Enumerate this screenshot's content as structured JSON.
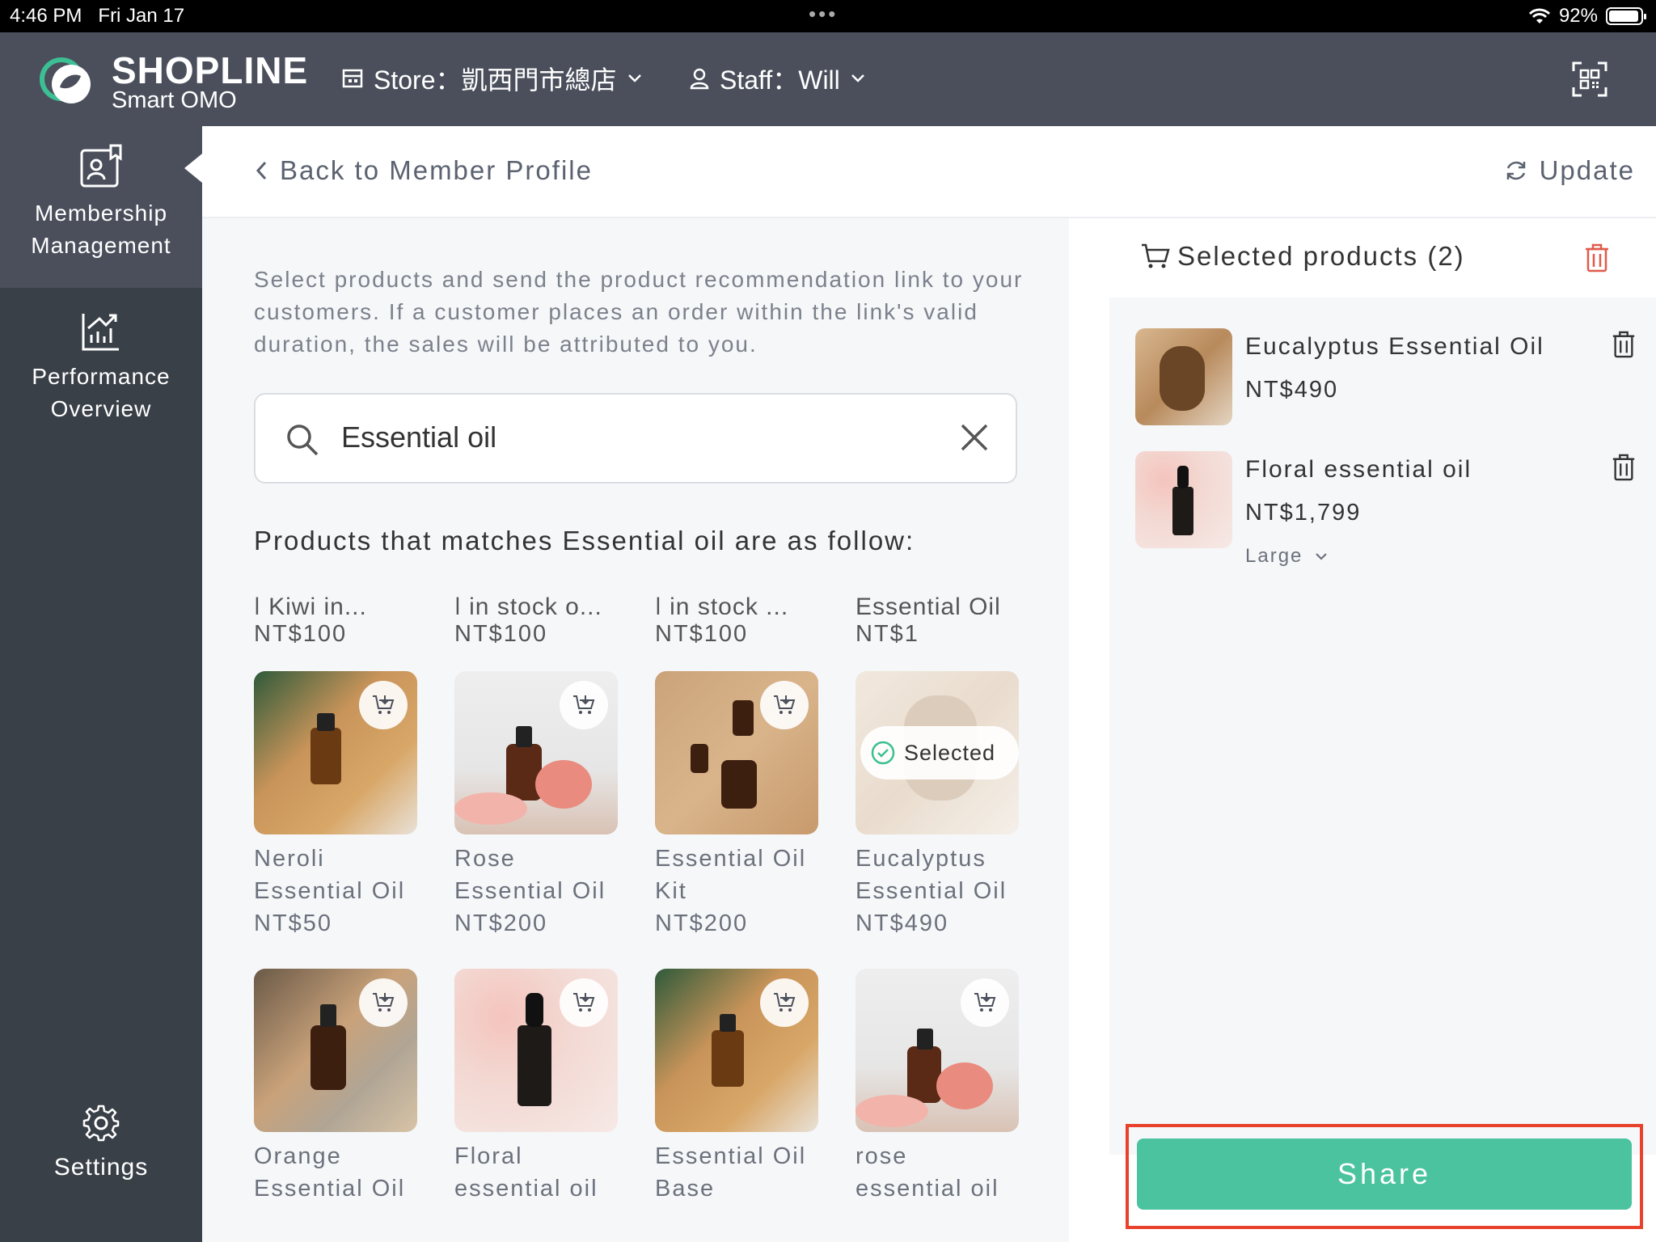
{
  "status": {
    "time": "4:46 PM",
    "date": "Fri Jan 17",
    "battery": "92%",
    "battery_level": 0.92
  },
  "topbar": {
    "brand": "SHOPLINE",
    "brand_sub": "Smart OMO",
    "store_label": "Store：凱西門市總店",
    "staff_label": "Staff：Will"
  },
  "sidebar": {
    "items": [
      {
        "label_1": "Membership",
        "label_2": "Management",
        "icon": "member-card-icon",
        "active": true
      },
      {
        "label_1": "Performance",
        "label_2": "Overview",
        "icon": "chart-icon",
        "active": false
      }
    ],
    "settings_label": "Settings"
  },
  "header": {
    "back_label": "Back to Member Profile",
    "update_label": "Update"
  },
  "main": {
    "description": "Select products and send the product recommendation link to your customers. If a customer places an order within the link's valid duration, the sales will be attributed to you.",
    "search": {
      "value": "Essential oil",
      "placeholder": ""
    },
    "results_title": "Products that matches Essential oil are as follow:",
    "partial_row": [
      {
        "name": "| Kiwi in...",
        "price": "NT$100"
      },
      {
        "name": "| in stock o...",
        "price": "NT$100"
      },
      {
        "name": "| in stock ...",
        "price": "NT$100"
      },
      {
        "name": "Essential Oil",
        "price": "NT$1"
      }
    ],
    "products": [
      {
        "name": "Neroli Essential Oil",
        "price": "NT$50",
        "image": "neroli"
      },
      {
        "name": "Rose Essential Oil",
        "price": "NT$200",
        "image": "rose"
      },
      {
        "name": "Essential Oil Kit",
        "price": "NT$200",
        "image": "kit"
      },
      {
        "name": "Eucalyptus Essential Oil",
        "price": "NT$490",
        "image": "eucalyptus",
        "selected": true
      },
      {
        "name": "Orange Essential Oil",
        "price": "",
        "image": "orange"
      },
      {
        "name": "Floral essential oil",
        "price": "",
        "image": "floral"
      },
      {
        "name": "Essential Oil Base",
        "price": "",
        "image": "base"
      },
      {
        "name": "rose essential oil",
        "price": "",
        "image": "rose2"
      }
    ],
    "selected_badge": "Selected"
  },
  "selected_panel": {
    "title": "Selected products (2)",
    "items": [
      {
        "name": "Eucalyptus Essential Oil",
        "price": "NT$490",
        "variant": ""
      },
      {
        "name": "Floral essential oil",
        "price": "NT$1,799",
        "variant": "Large"
      }
    ],
    "share_label": "Share"
  },
  "colors": {
    "accent": "#4ac39e",
    "header": "#4a4f5b",
    "sidebar": "#3a4048",
    "danger": "#e05a4a",
    "highlight": "#e8412c"
  }
}
